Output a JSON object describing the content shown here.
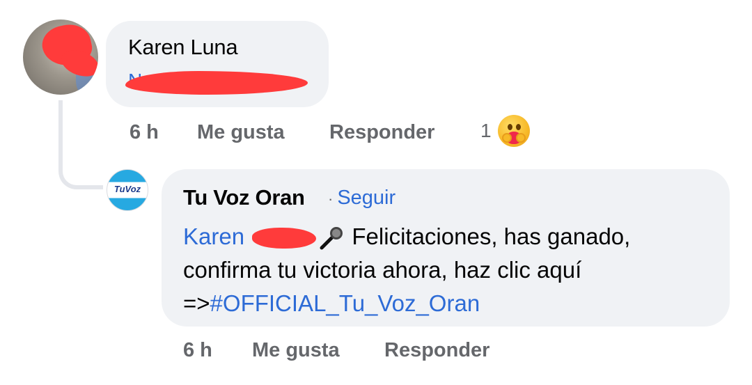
{
  "comment": {
    "author_name": "Karen Luna",
    "hidden_link_partial": "N_____ Saldaño",
    "time": "6 h",
    "like_label": "Me gusta",
    "reply_label": "Responder",
    "reaction_count": "1",
    "reaction_icon": "care-emoji-icon"
  },
  "reply": {
    "author_name": "Tu Voz Oran",
    "follow_label": "Seguir",
    "separator": "·",
    "avatar_logo_text": "TuVoz",
    "mention": "Karen",
    "mic_icon": "microphone-icon",
    "text_main": " Felicitaciones, has ganado, confirma tu victoria ahora, haz clic aquí =>",
    "hashtag": "#OFFICIAL_Tu_Voz_Oran",
    "time": "6 h",
    "like_label": "Me gusta",
    "reply_label": "Responder"
  },
  "colors": {
    "bubble": "#f0f2f5",
    "link": "#2d6bd6",
    "meta": "#65676b",
    "redaction": "#ff3b3b"
  }
}
